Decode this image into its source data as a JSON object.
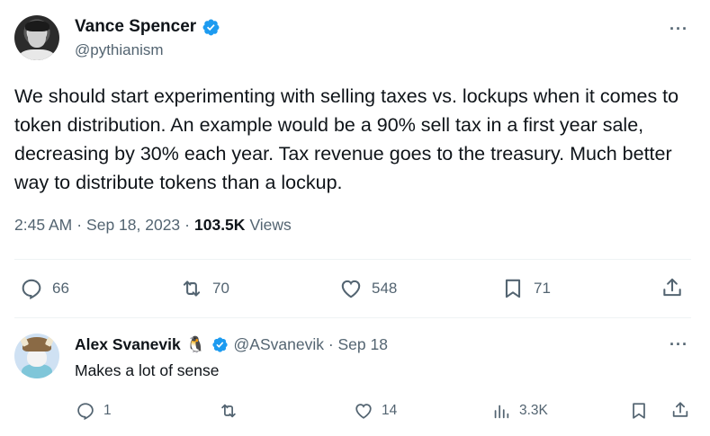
{
  "tweet": {
    "author_name": "Vance Spencer",
    "author_handle": "@pythianism",
    "more_label": "···",
    "text": "We should start experimenting with selling taxes vs. lockups when it comes to token distribution. An example would be a 90% sell tax in a first year sale, decreasing by 30% each year. Tax revenue goes to the treasury. Much better way to distribute tokens than a lockup.",
    "time": "2:45 AM",
    "sep1": "·",
    "date": "Sep 18, 2023",
    "sep2": "·",
    "views_count": "103.5K",
    "views_label": "Views",
    "stats": {
      "replies": "66",
      "reposts": "70",
      "likes": "548",
      "bookmarks": "71"
    }
  },
  "reply": {
    "author_name": "Alex Svanevik",
    "author_emoji": "🐧",
    "author_handle_date": "@ASvanevik · Sep 18",
    "more_label": "···",
    "text": "Makes a lot of sense",
    "stats": {
      "replies": "1",
      "reposts": "",
      "likes": "14",
      "views": "3.3K"
    }
  },
  "colors": {
    "text": "#0f1419",
    "secondary": "#536471",
    "verified": "#1d9bf0",
    "divider": "#eff3f4"
  },
  "icons": [
    "verified-badge-icon",
    "reply-icon",
    "repost-icon",
    "like-icon",
    "bookmark-icon",
    "share-icon",
    "views-icon",
    "more-icon"
  ]
}
